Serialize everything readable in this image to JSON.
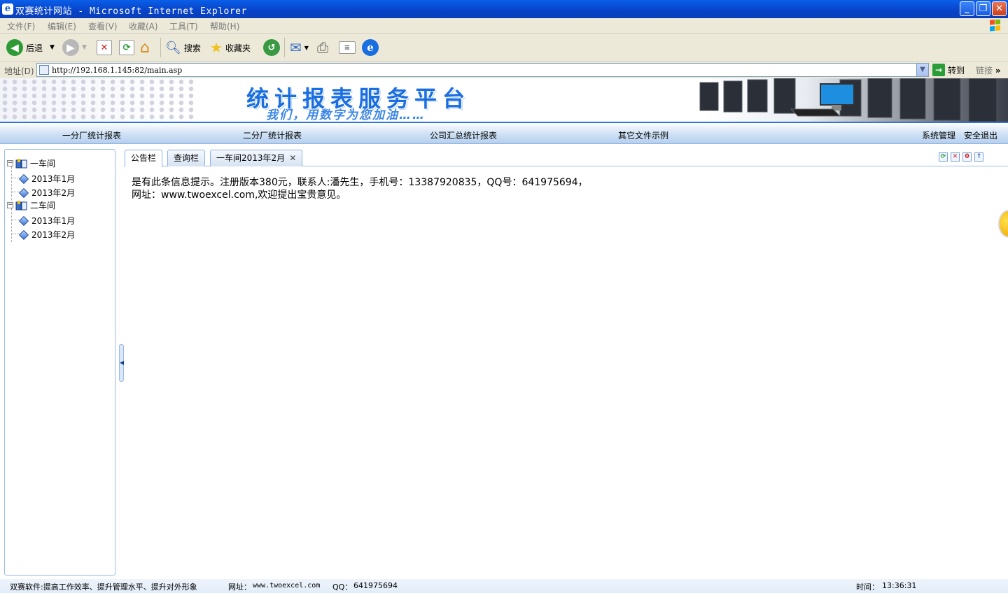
{
  "window": {
    "title": "双赛统计网站 - Microsoft Internet Explorer",
    "buttons": [
      "minimize",
      "restore",
      "close"
    ]
  },
  "menu": {
    "items": [
      "文件(F)",
      "编辑(E)",
      "查看(V)",
      "收藏(A)",
      "工具(T)",
      "帮助(H)"
    ]
  },
  "toolbar": {
    "back_label": "后退",
    "search_label": "搜索",
    "favorites_label": "收藏夹"
  },
  "address": {
    "label": "地址(D)",
    "url": "http://192.168.1.145:82/main.asp",
    "go_label": "转到",
    "links_label": "链接"
  },
  "banner": {
    "title": "统计报表服务平台",
    "subtitle": "我们，用数字为您加油……"
  },
  "nav": {
    "items": [
      "一分厂统计报表",
      "二分厂统计报表",
      "公司汇总统计报表",
      "其它文件示例"
    ],
    "right_items": [
      "系统管理",
      "安全退出"
    ]
  },
  "tree": [
    {
      "label": "一车间",
      "children": [
        "2013年1月",
        "2013年2月"
      ]
    },
    {
      "label": "二车间",
      "children": [
        "2013年1月",
        "2013年2月"
      ]
    }
  ],
  "tabs": [
    {
      "label": "公告栏",
      "active": true
    },
    {
      "label": "查询栏",
      "active": false
    },
    {
      "label": "一车间2013年2月",
      "active": false,
      "closable": true
    }
  ],
  "tab_tools": [
    "refresh-icon",
    "close-icon",
    "zero-icon",
    "up-icon"
  ],
  "content": {
    "line1": "是有此条信息提示。注册版本380元，联系人:潘先生，手机号：13387920835，QQ号：641975694，",
    "line2": "网址：www.twoexcel.com,欢迎提出宝贵意见。"
  },
  "status": {
    "slogan": "双赛软件:提高工作效率、提升管理水平、提升对外形象",
    "site_label": "网址：",
    "site": "www.twoexcel.com",
    "qq_label": "QQ：",
    "qq": "641975694",
    "time_label": "时间：",
    "time": "13:36:31"
  },
  "colors": {
    "titlebar": "#0842c8",
    "banner_title": "#1a6ee0",
    "panel_border": "#99bbe8",
    "nav_bg": "#cfe1f5"
  }
}
